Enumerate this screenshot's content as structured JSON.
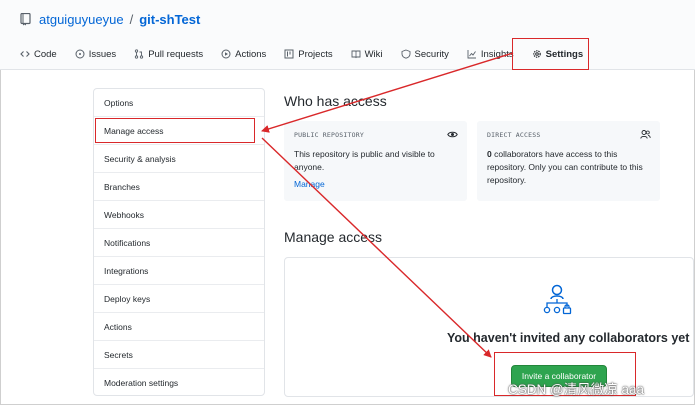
{
  "repo": {
    "owner": "atguiguyueyue",
    "separator": "/",
    "name": "git-shTest"
  },
  "tabs": [
    {
      "label": "Code",
      "icon": "code-icon"
    },
    {
      "label": "Issues",
      "icon": "issue-icon"
    },
    {
      "label": "Pull requests",
      "icon": "pull-request-icon"
    },
    {
      "label": "Actions",
      "icon": "play-icon"
    },
    {
      "label": "Projects",
      "icon": "project-icon"
    },
    {
      "label": "Wiki",
      "icon": "book-icon"
    },
    {
      "label": "Security",
      "icon": "shield-icon"
    },
    {
      "label": "Insights",
      "icon": "graph-icon"
    },
    {
      "label": "Settings",
      "icon": "gear-icon"
    }
  ],
  "sidebar": {
    "items": [
      {
        "label": "Options"
      },
      {
        "label": "Manage access"
      },
      {
        "label": "Security & analysis"
      },
      {
        "label": "Branches"
      },
      {
        "label": "Webhooks"
      },
      {
        "label": "Notifications"
      },
      {
        "label": "Integrations"
      },
      {
        "label": "Deploy keys"
      },
      {
        "label": "Actions"
      },
      {
        "label": "Secrets"
      },
      {
        "label": "Moderation settings"
      }
    ]
  },
  "who_has_access": {
    "title": "Who has access",
    "public_card": {
      "label": "PUBLIC REPOSITORY",
      "text": "This repository is public and visible to anyone.",
      "link": "Manage",
      "icon": "eye-icon"
    },
    "direct_card": {
      "label": "DIRECT ACCESS",
      "count": "0",
      "text": " collaborators have access to this repository. Only you can contribute to this repository.",
      "icon": "people-icon"
    }
  },
  "manage_access": {
    "title": "Manage access",
    "empty_message": "You haven't invited any collaborators yet",
    "invite_button": "Invite a collaborator",
    "icon": "collaborators-icon"
  },
  "watermark": "CSDN @清风微凉 aaa",
  "colors": {
    "link": "#0366d6",
    "annotation_red": "#d9282a",
    "primary_button": "#2ea44f"
  }
}
